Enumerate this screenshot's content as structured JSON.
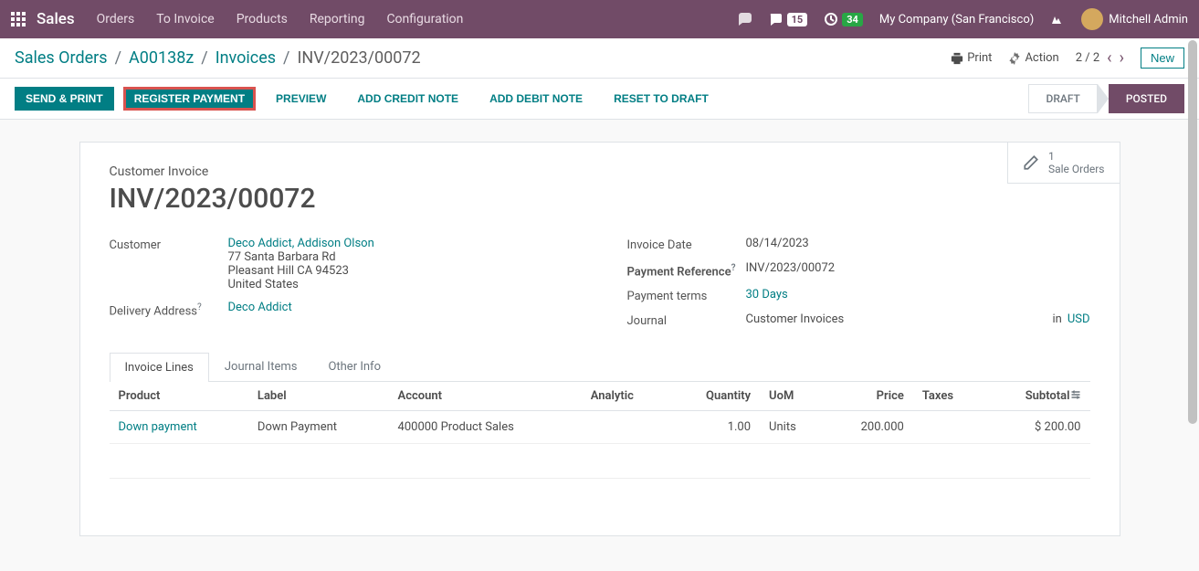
{
  "topbar": {
    "brand": "Sales",
    "menu": [
      "Orders",
      "To Invoice",
      "Products",
      "Reporting",
      "Configuration"
    ],
    "chat_badge": "15",
    "activity_badge": "34",
    "company": "My Company (San Francisco)",
    "user": "Mitchell Admin"
  },
  "breadcrumb": {
    "items": [
      "Sales Orders",
      "A00138z",
      "Invoices"
    ],
    "current": "INV/2023/00072"
  },
  "cp": {
    "print": "Print",
    "action": "Action",
    "pager": "2 / 2",
    "new": "New"
  },
  "actions": {
    "send_print": "SEND & PRINT",
    "register_payment": "REGISTER PAYMENT",
    "preview": "PREVIEW",
    "add_credit": "ADD CREDIT NOTE",
    "add_debit": "ADD DEBIT NOTE",
    "reset_draft": "RESET TO DRAFT"
  },
  "status": {
    "draft": "DRAFT",
    "posted": "POSTED"
  },
  "button_box": {
    "count": "1",
    "label": "Sale Orders"
  },
  "form": {
    "title_label": "Customer Invoice",
    "title": "INV/2023/00072",
    "customer_label": "Customer",
    "customer_link": "Deco Addict, Addison Olson",
    "customer_addr1": "77 Santa Barbara Rd",
    "customer_addr2": "Pleasant Hill CA 94523",
    "customer_addr3": "United States",
    "delivery_label": "Delivery Address",
    "delivery_value": "Deco Addict",
    "invoice_date_label": "Invoice Date",
    "invoice_date_value": "08/14/2023",
    "payment_ref_label": "Payment Reference",
    "payment_ref_value": "INV/2023/00072",
    "payment_terms_label": "Payment terms",
    "payment_terms_value": "30 Days",
    "journal_label": "Journal",
    "journal_value": "Customer Invoices",
    "journal_in": "in",
    "journal_currency": "USD"
  },
  "tabs": {
    "invoice_lines": "Invoice Lines",
    "journal_items": "Journal Items",
    "other_info": "Other Info"
  },
  "table": {
    "headers": {
      "product": "Product",
      "label": "Label",
      "account": "Account",
      "analytic": "Analytic",
      "quantity": "Quantity",
      "uom": "UoM",
      "price": "Price",
      "taxes": "Taxes",
      "subtotal": "Subtotal"
    },
    "rows": [
      {
        "product": "Down payment",
        "label": "Down Payment",
        "account": "400000 Product Sales",
        "analytic": "",
        "quantity": "1.00",
        "uom": "Units",
        "price": "200.000",
        "taxes": "",
        "subtotal": "$ 200.00"
      }
    ]
  }
}
